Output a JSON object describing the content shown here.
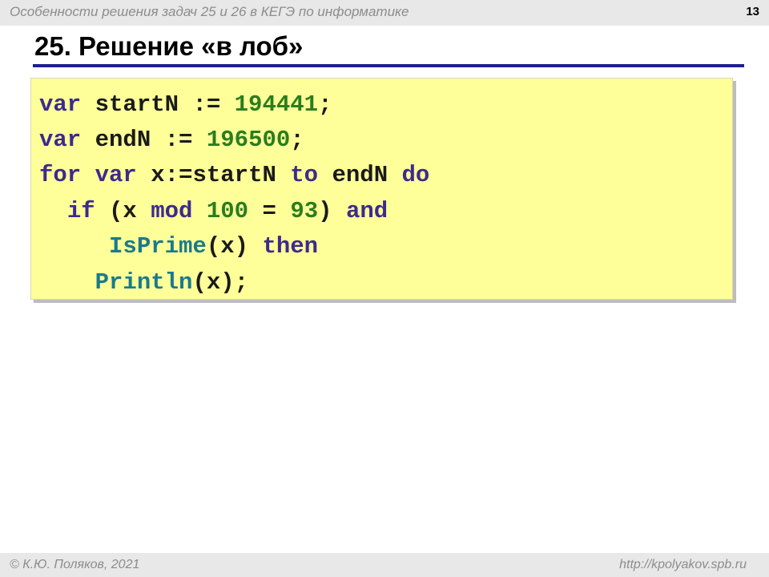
{
  "header": {
    "text": "Особенности решения задач 25 и 26 в КЕГЭ по информатике",
    "page_number": "13"
  },
  "slide": {
    "title": "25. Решение «в лоб»"
  },
  "code": {
    "lines": [
      [
        {
          "t": "var",
          "k": "kw"
        },
        {
          "t": " startN := ",
          "k": "txt"
        },
        {
          "t": "194441",
          "k": "num"
        },
        {
          "t": ";",
          "k": "txt"
        }
      ],
      [
        {
          "t": "var",
          "k": "kw"
        },
        {
          "t": " endN := ",
          "k": "txt"
        },
        {
          "t": "196500",
          "k": "num"
        },
        {
          "t": ";",
          "k": "txt"
        }
      ],
      [
        {
          "t": "for",
          "k": "kw"
        },
        {
          "t": " ",
          "k": "txt"
        },
        {
          "t": "var",
          "k": "kw"
        },
        {
          "t": " x:=startN ",
          "k": "txt"
        },
        {
          "t": "to",
          "k": "kw"
        },
        {
          "t": " endN ",
          "k": "txt"
        },
        {
          "t": "do",
          "k": "kw"
        }
      ],
      [
        {
          "t": "  ",
          "k": "txt"
        },
        {
          "t": "if",
          "k": "kw"
        },
        {
          "t": " (x ",
          "k": "txt"
        },
        {
          "t": "mod",
          "k": "kw"
        },
        {
          "t": " ",
          "k": "txt"
        },
        {
          "t": "100",
          "k": "num"
        },
        {
          "t": " = ",
          "k": "txt"
        },
        {
          "t": "93",
          "k": "num"
        },
        {
          "t": ") ",
          "k": "txt"
        },
        {
          "t": "and",
          "k": "kw"
        }
      ],
      [
        {
          "t": "     ",
          "k": "txt"
        },
        {
          "t": "IsPrime",
          "k": "fn"
        },
        {
          "t": "(x) ",
          "k": "txt"
        },
        {
          "t": "then",
          "k": "kw"
        }
      ],
      [
        {
          "t": "    ",
          "k": "txt"
        },
        {
          "t": "Println",
          "k": "fn"
        },
        {
          "t": "(x);",
          "k": "txt"
        }
      ]
    ]
  },
  "footer": {
    "left": "© К.Ю. Поляков, 2021",
    "right": "http://kpolyakov.spb.ru"
  },
  "colors": {
    "code_background": "#ffff99",
    "keyword": "#3d2a8c",
    "number": "#2b7d1e",
    "function": "#1a7a8c",
    "title_rule": "#1f1f8f"
  }
}
